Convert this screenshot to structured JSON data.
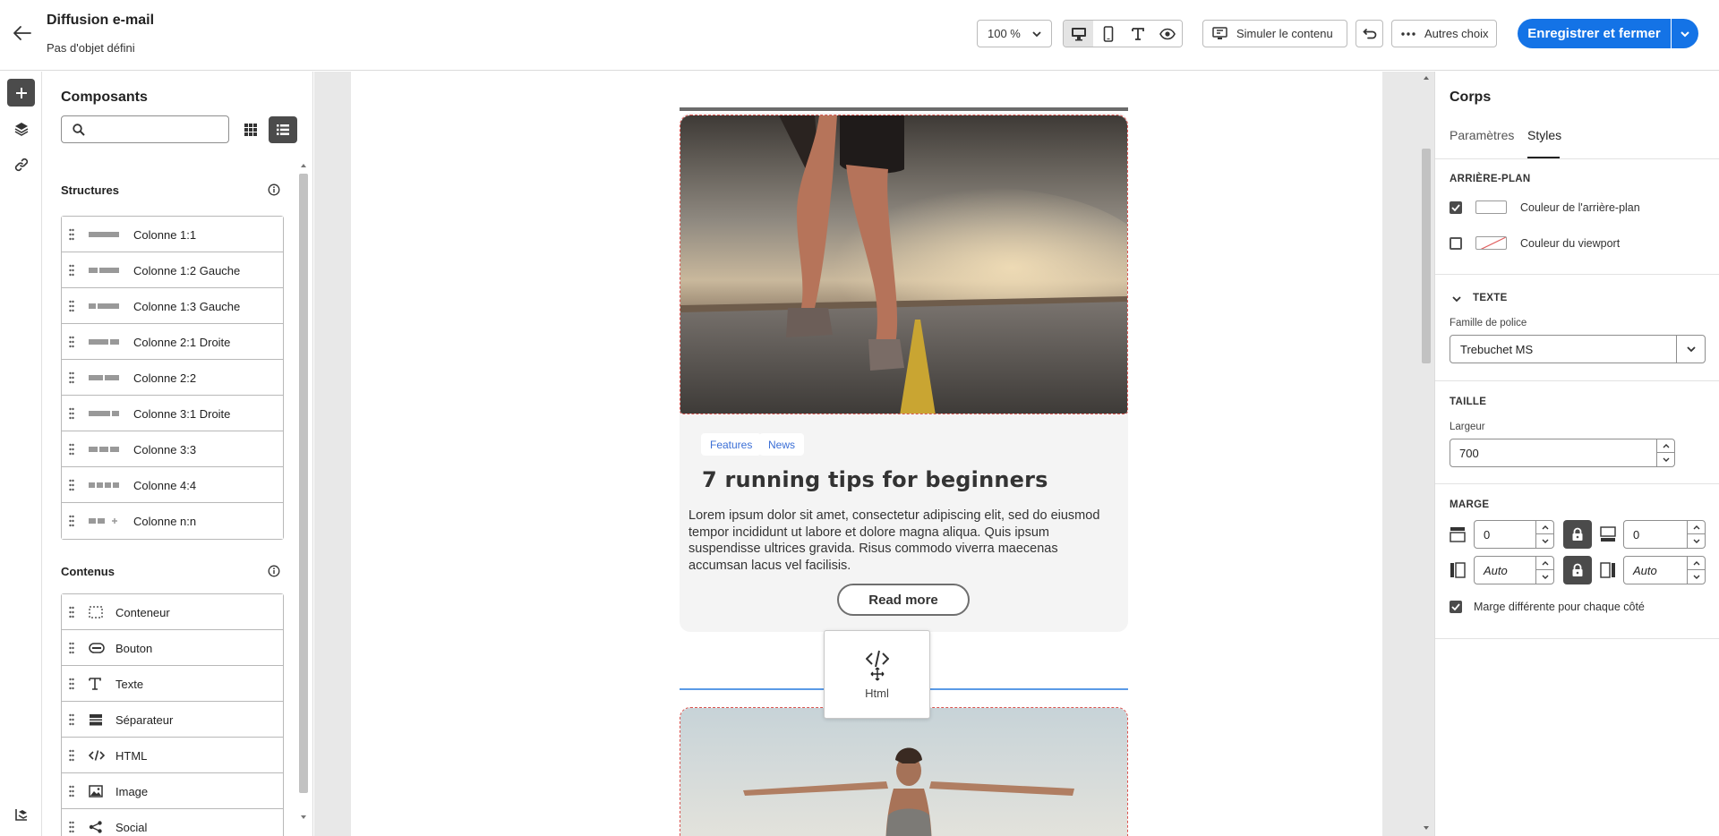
{
  "header": {
    "title": "Diffusion e-mail",
    "subtitle": "Pas d'objet défini",
    "zoom": "100 %",
    "simulate_label": "Simuler le contenu",
    "more_label": "Autres choix",
    "save_label": "Enregistrer et fermer",
    "accent": "#1473e6"
  },
  "components_panel": {
    "title": "Composants",
    "search_placeholder": "",
    "structures_title": "Structures",
    "structures": [
      {
        "label": "Colonne 1:1",
        "icon": "column-1-1-icon"
      },
      {
        "label": "Colonne 1:2 Gauche",
        "icon": "column-1-2-icon"
      },
      {
        "label": "Colonne 1:3 Gauche",
        "icon": "column-1-3-icon"
      },
      {
        "label": "Colonne 2:1 Droite",
        "icon": "column-2-1-icon"
      },
      {
        "label": "Colonne 2:2",
        "icon": "column-2-2-icon"
      },
      {
        "label": "Colonne 3:1 Droite",
        "icon": "column-3-1-icon"
      },
      {
        "label": "Colonne 3:3",
        "icon": "column-3-3-icon"
      },
      {
        "label": "Colonne 4:4",
        "icon": "column-4-4-icon"
      },
      {
        "label": "Colonne n:n",
        "icon": "column-n-n-icon"
      }
    ],
    "contents_title": "Contenus",
    "contents": [
      {
        "label": "Conteneur",
        "icon": "container-icon"
      },
      {
        "label": "Bouton",
        "icon": "button-icon"
      },
      {
        "label": "Texte",
        "icon": "text-icon"
      },
      {
        "label": "Séparateur",
        "icon": "divider-icon"
      },
      {
        "label": "HTML",
        "icon": "code-icon"
      },
      {
        "label": "Image",
        "icon": "image-icon"
      },
      {
        "label": "Social",
        "icon": "share-icon"
      }
    ]
  },
  "canvas": {
    "tags": [
      "Features",
      "News"
    ],
    "article_title": "7 running tips for beginners",
    "article_body": "Lorem ipsum dolor sit amet, consectetur adipiscing elit, sed do eiusmod tempor incididunt ut labore et dolore magna aliqua. Quis ipsum suspendisse ultrices gravida. Risus commodo viverra maecenas accumsan lacus vel facilisis.",
    "read_more": "Read more",
    "drag_label": "Html"
  },
  "properties": {
    "title": "Corps",
    "tabs": [
      "Paramètres",
      "Styles"
    ],
    "active_tab": "Styles",
    "background_section": "ARRIÈRE-PLAN",
    "bg_color_label": "Couleur de l'arrière-plan",
    "bg_color_checked": true,
    "viewport_color_label": "Couleur du viewport",
    "viewport_color_checked": false,
    "text_section": "TEXTE",
    "font_family_label": "Famille de police",
    "font_family_value": "Trebuchet MS",
    "size_section": "TAILLE",
    "width_label": "Largeur",
    "width_value": "700",
    "margin_section": "MARGE",
    "margin_top": "0",
    "margin_bottom": "0",
    "margin_left": "Auto",
    "margin_right": "Auto",
    "different_margin_label": "Marge différente pour chaque côté",
    "different_margin_checked": true
  }
}
